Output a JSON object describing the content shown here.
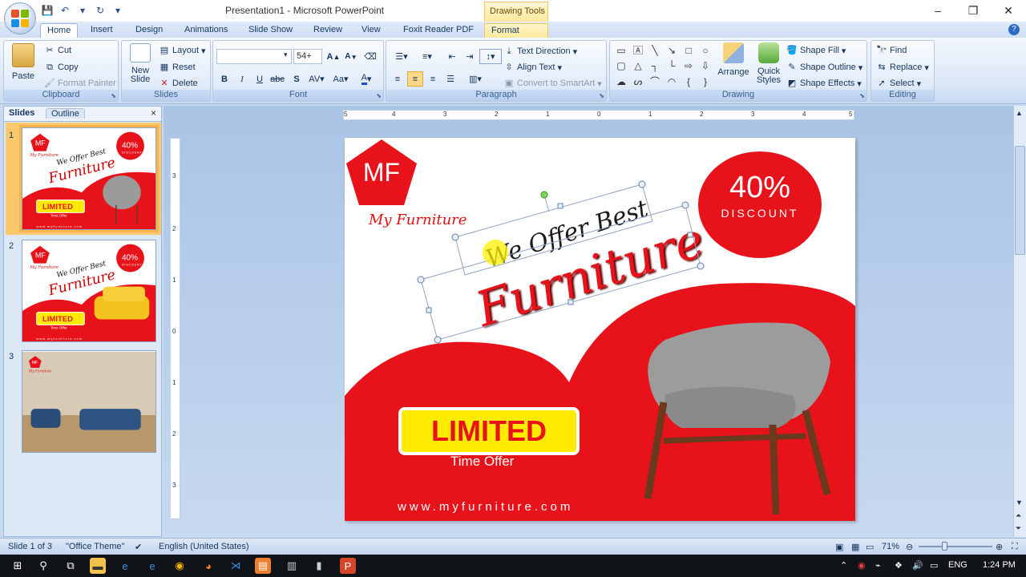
{
  "window": {
    "title": "Presentation1 - Microsoft PowerPoint",
    "contextual_header": "Drawing Tools",
    "controls": [
      "–",
      "❐",
      "✕"
    ]
  },
  "tabs": [
    "Home",
    "Insert",
    "Design",
    "Animations",
    "Slide Show",
    "Review",
    "View",
    "Foxit Reader PDF",
    "Format"
  ],
  "ribbon": {
    "clipboard": {
      "label": "Clipboard",
      "paste": "Paste",
      "cut": "Cut",
      "copy": "Copy",
      "format_painter": "Format Painter"
    },
    "slides": {
      "label": "Slides",
      "new_slide": "New Slide",
      "layout": "Layout",
      "reset": "Reset",
      "delete": "Delete"
    },
    "font": {
      "label": "Font",
      "font_name": "",
      "font_size": "54+"
    },
    "paragraph": {
      "label": "Paragraph",
      "text_direction": "Text Direction",
      "align_text": "Align Text",
      "convert_smartart": "Convert to SmartArt"
    },
    "drawing": {
      "label": "Drawing",
      "arrange": "Arrange",
      "quick_styles": "Quick Styles",
      "shape_fill": "Shape Fill",
      "shape_outline": "Shape Outline",
      "shape_effects": "Shape Effects"
    },
    "editing": {
      "label": "Editing",
      "find": "Find",
      "replace": "Replace",
      "select": "Select"
    }
  },
  "left_panel": {
    "tabs": [
      "Slides",
      "Outline"
    ],
    "slide_numbers": [
      "1",
      "2",
      "3"
    ],
    "thumb1": {
      "logo": "MF",
      "brand": "My Furniture",
      "line1": "We Offer Best",
      "line2": "Furniture",
      "pct": "40%",
      "disc": "DISCOUNT",
      "limited": "LIMITED",
      "offer": "Time Offer",
      "site": "www.myfurniture.com"
    },
    "thumb2": {
      "logo": "MF",
      "brand": "My Furniture",
      "line1": "We Offer Best",
      "line2": "Furniture",
      "pct": "40%",
      "disc": "DISCOUNT",
      "limited": "LIMITED",
      "offer": "Time Offer",
      "site": "www.myfurniture.com"
    },
    "thumb3": {
      "logo": "MF",
      "brand": "My Furniture"
    }
  },
  "ruler": {
    "horizontal": [
      "5",
      "4",
      "3",
      "2",
      "1",
      "0",
      "1",
      "2",
      "3",
      "4",
      "5"
    ],
    "vertical": [
      "3",
      "2",
      "1",
      "0",
      "1",
      "2",
      "3"
    ]
  },
  "slide": {
    "logo_text": "MF",
    "brand_name": "My Furniture",
    "headline_small": "We Offer Best",
    "headline_big": "Furniture",
    "discount_pct": "40%",
    "discount_word": "DISCOUNT",
    "limited": "LIMITED",
    "time_offer": "Time Offer",
    "website": "www.myfurniture.com"
  },
  "statusbar": {
    "slide_info": "Slide 1 of 3",
    "theme": "\"Office Theme\"",
    "language": "English (United States)",
    "zoom": "71%"
  },
  "taskbar": {
    "language": "ENG",
    "time": "1:24 PM"
  },
  "colors": {
    "slide_red": "#e8121a",
    "limited_yellow": "#ffeb00",
    "ribbon_blue": "#dbe7f7"
  }
}
